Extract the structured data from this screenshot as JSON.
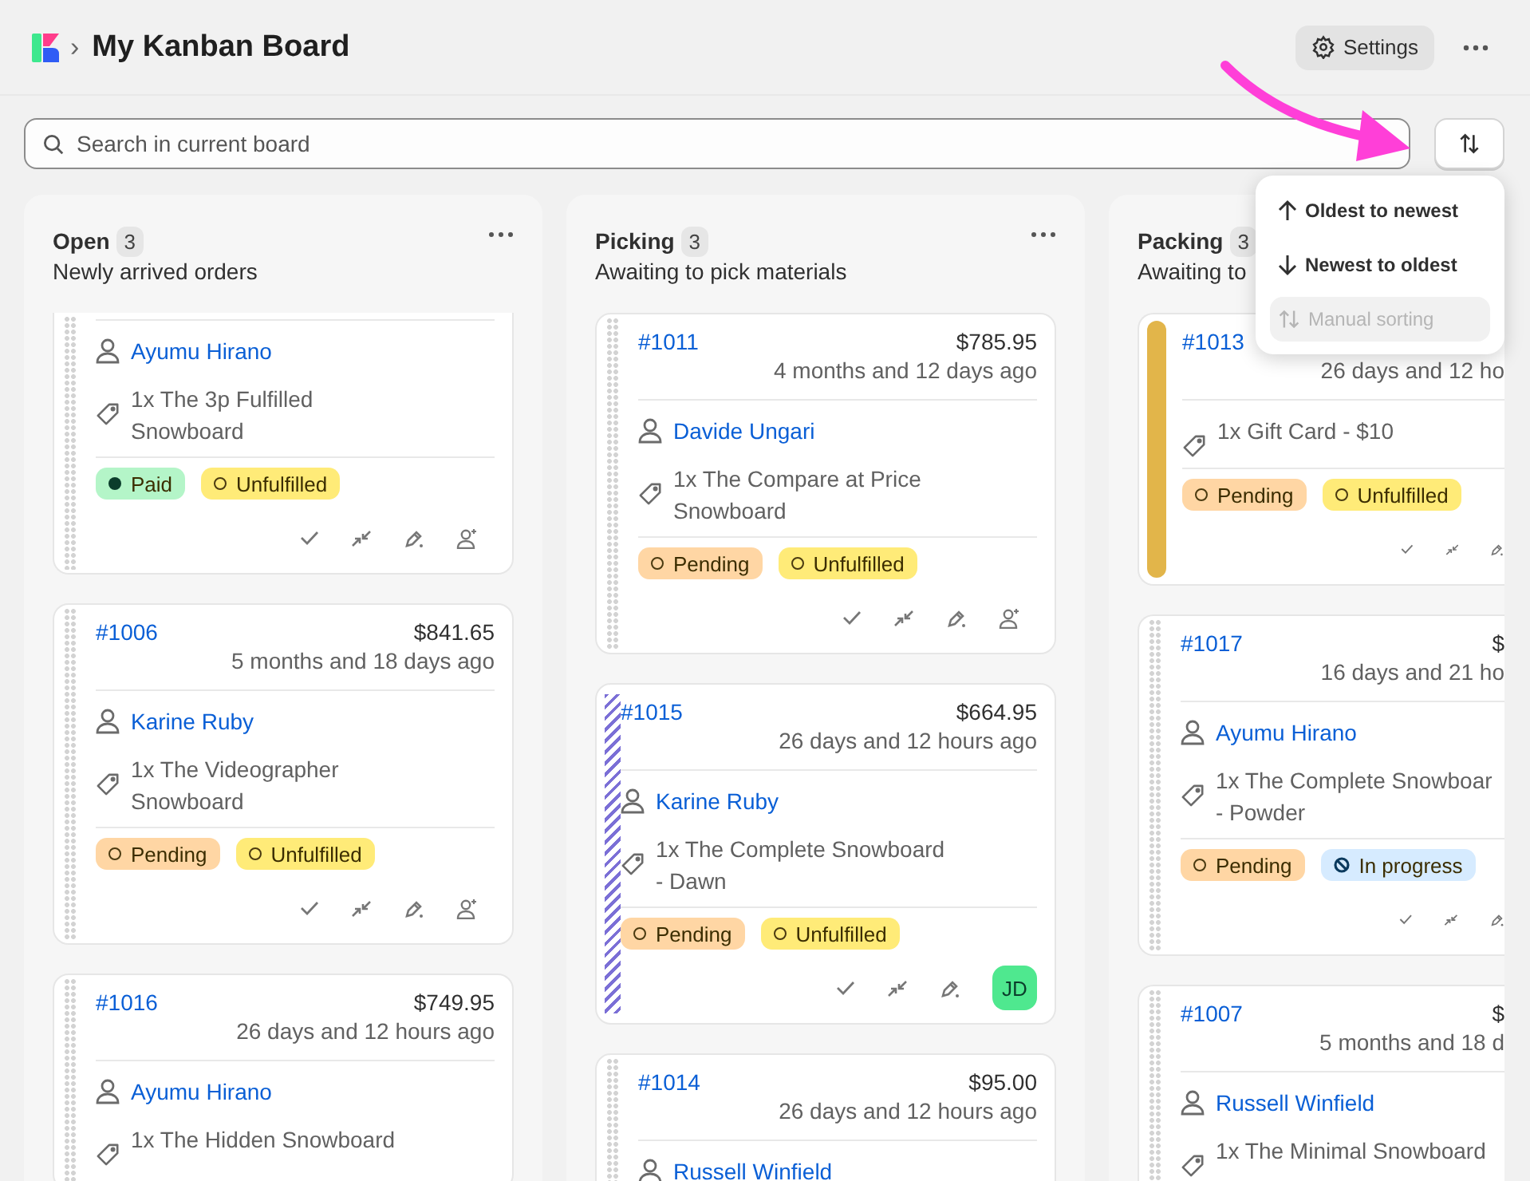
{
  "header": {
    "breadcrumb_separator": "›",
    "title": "My Kanban Board",
    "settings_button": "Settings"
  },
  "search": {
    "placeholder": "Search in current board"
  },
  "sort_menu": {
    "items": [
      {
        "kind": "up",
        "label": "Oldest to newest",
        "disabled": false
      },
      {
        "kind": "down",
        "label": "Newest to oldest",
        "disabled": false
      },
      {
        "kind": "updown",
        "label": "Manual sorting",
        "disabled": true
      }
    ]
  },
  "columns": [
    {
      "title": "Open",
      "count": "3",
      "description": "Newly arrived orders",
      "menu_button": true,
      "cut_right": false,
      "cards": [
        {
          "cut_top": true,
          "handle": {
            "kind": "dots"
          },
          "customer": "Ayumu Hirano",
          "product_lines": [
            "1x The 3p Fulfilled",
            "Snowboard"
          ],
          "badges": [
            {
              "kind": "dot",
              "label": "Paid",
              "color": "#b4f5c8"
            },
            {
              "kind": "ring",
              "label": "Unfulfilled",
              "color": "#ffeb78"
            }
          ],
          "actions": [
            {
              "kind": "check"
            },
            {
              "kind": "merge"
            },
            {
              "kind": "pen"
            },
            {
              "kind": "assign"
            }
          ]
        },
        {
          "cut_top": false,
          "handle": {
            "kind": "dots"
          },
          "id": "#1006",
          "price": "$841.65",
          "time": "5 months and 18 days ago",
          "customer": "Karine Ruby",
          "product_lines": [
            "1x The Videographer",
            "Snowboard"
          ],
          "badges": [
            {
              "kind": "ring",
              "label": "Pending",
              "color": "#ffd6a4"
            },
            {
              "kind": "ring",
              "label": "Unfulfilled",
              "color": "#ffeb78"
            }
          ],
          "actions": [
            {
              "kind": "check"
            },
            {
              "kind": "merge"
            },
            {
              "kind": "pen"
            },
            {
              "kind": "assign"
            }
          ]
        },
        {
          "cut_top": false,
          "handle": {
            "kind": "dots"
          },
          "id": "#1016",
          "price": "$749.95",
          "time": "26 days and 12 hours ago",
          "customer": "Ayumu Hirano",
          "product_lines": [
            "1x The Hidden Snowboard"
          ]
        }
      ]
    },
    {
      "title": "Picking",
      "count": "3",
      "description": "Awaiting to pick materials",
      "menu_button": true,
      "cut_right": false,
      "cards": [
        {
          "cut_top": false,
          "handle": {
            "kind": "dots"
          },
          "id": "#1011",
          "price": "$785.95",
          "time": "4 months and 12 days ago",
          "customer": "Davide Ungari",
          "product_lines": [
            "1x The Compare at Price",
            "Snowboard"
          ],
          "badges": [
            {
              "kind": "ring",
              "label": "Pending",
              "color": "#ffd6a4"
            },
            {
              "kind": "ring",
              "label": "Unfulfilled",
              "color": "#ffeb78"
            }
          ],
          "actions": [
            {
              "kind": "check"
            },
            {
              "kind": "merge"
            },
            {
              "kind": "pen"
            },
            {
              "kind": "assign"
            }
          ]
        },
        {
          "cut_top": false,
          "handle": {
            "kind": "striped",
            "color": "#7b6fd6"
          },
          "id": "#1015",
          "price": "$664.95",
          "time": "26 days and 12 hours ago",
          "customer": "Karine Ruby",
          "product_lines": [
            "1x The Complete Snowboard",
            "- Dawn"
          ],
          "badges": [
            {
              "kind": "ring",
              "label": "Pending",
              "color": "#ffd6a4"
            },
            {
              "kind": "ring",
              "label": "Unfulfilled",
              "color": "#ffeb78"
            }
          ],
          "actions": [
            {
              "kind": "check"
            },
            {
              "kind": "merge"
            },
            {
              "kind": "pen"
            },
            {
              "kind": "avatar",
              "text": "JD",
              "color": "#4fe88f"
            }
          ]
        },
        {
          "cut_top": false,
          "handle": {
            "kind": "dots"
          },
          "id": "#1014",
          "price": "$95.00",
          "time": "26 days and 12 hours ago",
          "customer": "Russell Winfield"
        }
      ]
    },
    {
      "title": "Packing",
      "count": "3",
      "description": "Awaiting to",
      "menu_button": false,
      "cut_right": true,
      "cards": [
        {
          "cut_top": false,
          "handle": {
            "kind": "solid",
            "color": "#e2b54a"
          },
          "id": "#1013",
          "time": "26 days and 12 ho",
          "product_lines": [
            "1x Gift Card - $10"
          ],
          "badges": [
            {
              "kind": "ring",
              "label": "Pending",
              "color": "#ffd6a4"
            },
            {
              "kind": "ring",
              "label": "Unfulfilled",
              "color": "#ffeb78"
            }
          ],
          "actions": [
            {
              "kind": "check"
            },
            {
              "kind": "merge"
            },
            {
              "kind": "pen"
            }
          ]
        },
        {
          "cut_top": false,
          "handle": {
            "kind": "dots"
          },
          "id": "#1017",
          "price": "$",
          "time": "16 days and 21 ho",
          "customer": "Ayumu Hirano",
          "product_lines": [
            "1x The Complete Snowboar",
            "- Powder"
          ],
          "badges": [
            {
              "kind": "ring",
              "label": "Pending",
              "color": "#ffd6a4"
            },
            {
              "kind": "blocked",
              "label": "In progress",
              "color": "#d6ebff"
            }
          ],
          "actions": [
            {
              "kind": "check"
            },
            {
              "kind": "merge"
            },
            {
              "kind": "pen"
            }
          ]
        },
        {
          "cut_top": false,
          "handle": {
            "kind": "dots"
          },
          "id": "#1007",
          "price": "$",
          "time": "5 months and 18 d",
          "customer": "Russell Winfield",
          "product_lines": [
            "1x The Minimal Snowboard"
          ]
        }
      ]
    }
  ]
}
